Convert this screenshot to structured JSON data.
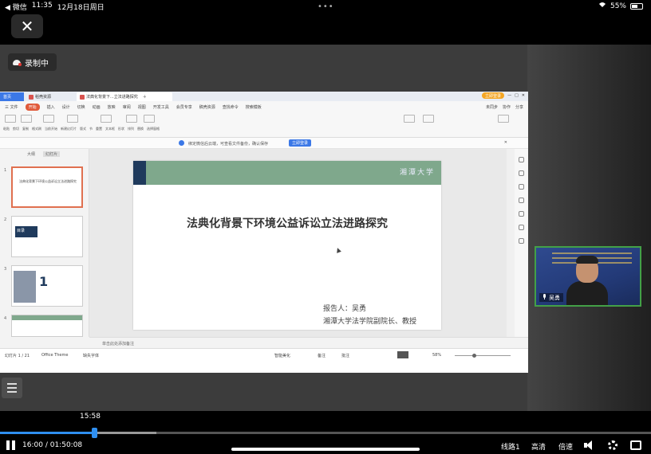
{
  "status_bar": {
    "back_app": "◀ 微信",
    "time": "11:35",
    "date": "12月18日周日",
    "dots": "•••",
    "battery": "55%"
  },
  "recording_label": "录制中",
  "wps": {
    "tabs": [
      {
        "label": "首页"
      },
      {
        "label": "稻壳资源"
      },
      {
        "label": "法典化背景下...立法进路探究"
      }
    ],
    "login_label": "立即登录",
    "menu": [
      "三 文件",
      "开始",
      "插入",
      "设计",
      "切换",
      "动画",
      "放映",
      "审阅",
      "视图",
      "开发工具",
      "会员专享",
      "稿壳资源",
      "查找命令",
      "搜索模板"
    ],
    "menu_right": [
      "未同步",
      "协作",
      "分享"
    ],
    "ribbon_labels": [
      "粘贴",
      "剪切",
      "复制",
      "格式刷",
      "当前开始",
      "新建幻灯片",
      "版式",
      "节",
      "重置",
      "文本框",
      "形状",
      "排列",
      "替换",
      "选择窗格"
    ],
    "notice_text": "绑定微信后云端，可查看文件备份，确认保存",
    "notice_button": "立即登录",
    "sidebar_tabs": [
      "大纲",
      "幻灯片"
    ],
    "thumbnails": [
      {
        "num": "1",
        "text": "法典化背景下环境公益诉讼立法进路探究"
      },
      {
        "num": "2",
        "text": "目录"
      },
      {
        "num": "3",
        "text": "1"
      },
      {
        "num": "4",
        "text": ""
      }
    ],
    "slide": {
      "university": "湘潭大学",
      "title": "法典化背景下环境公益诉讼立法进路探究",
      "reporter": "报告人：吴勇",
      "affiliation": "湘潭大学法学院副院长、教授"
    },
    "notes_placeholder": "单击此处添加备注",
    "status": {
      "slide_counter": "幻灯片 1 / 21",
      "theme": "Office Theme",
      "font_missing": "缺失字体",
      "smart_beautify": "智能美化",
      "notes": "备注",
      "comment": "批注",
      "zoom": "58%"
    }
  },
  "webcam": {
    "name": "吴勇"
  },
  "player": {
    "hover_time": "15:58",
    "current_time": "16:00",
    "separator": "/",
    "total_time": "01:50:08",
    "progress_fraction": 0.145,
    "buffered_fraction": 0.24,
    "line": "线路1",
    "quality": "高清",
    "speed": "倍速"
  }
}
